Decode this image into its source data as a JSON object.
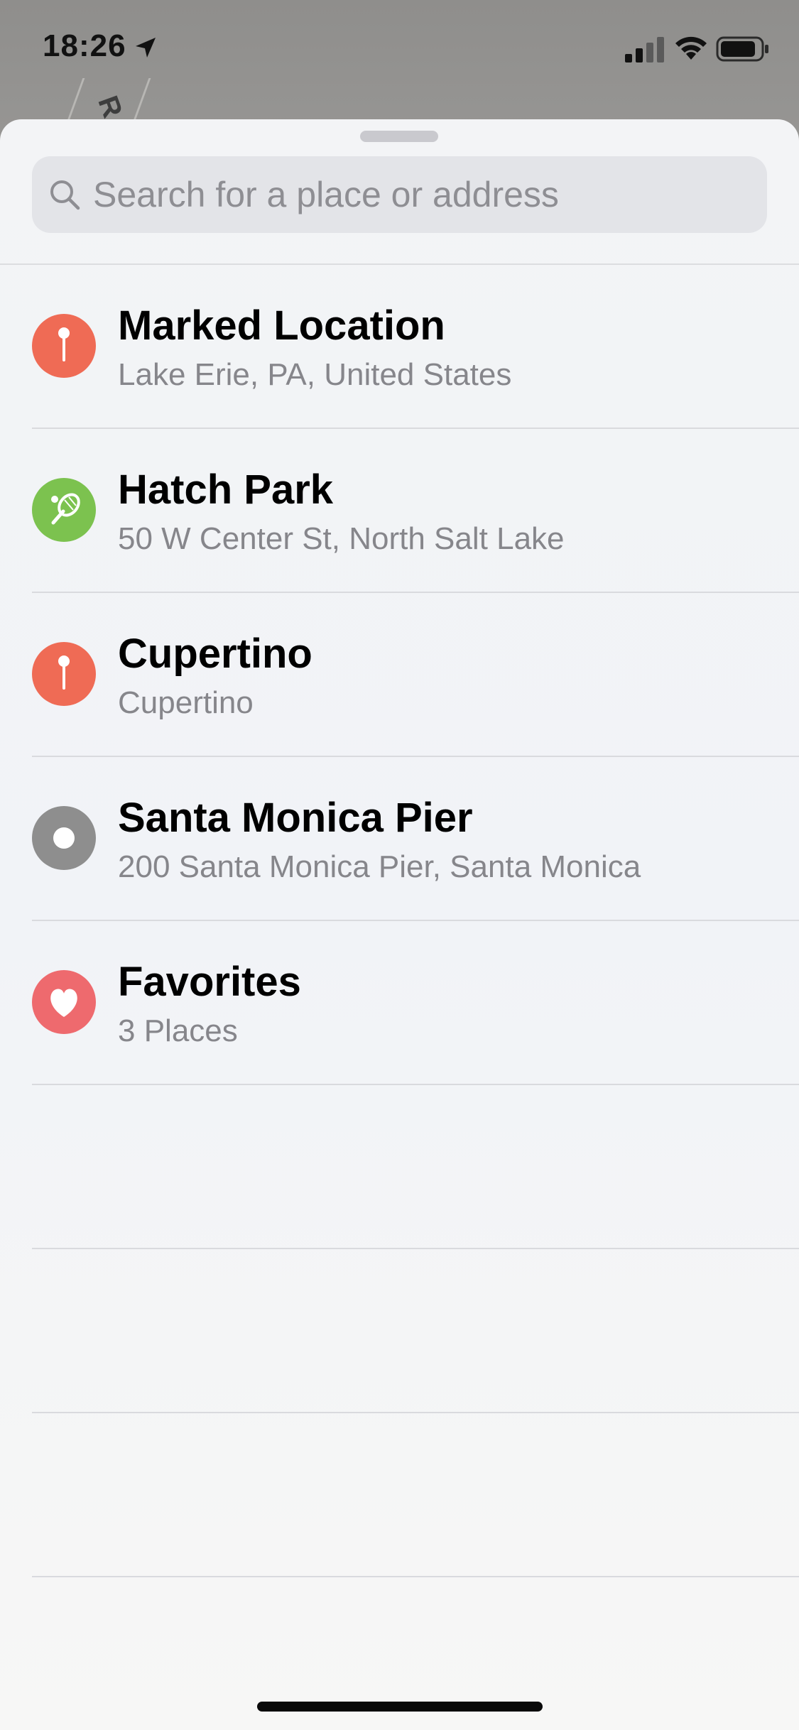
{
  "status_bar": {
    "time": "18:26"
  },
  "map": {
    "road_label": "R"
  },
  "search": {
    "placeholder": "Search for a place or address"
  },
  "places": [
    {
      "title": "Marked Location",
      "subtitle": "Lake Erie, PA, United States",
      "icon": "pin-icon",
      "color": "#ef6b55"
    },
    {
      "title": "Hatch Park",
      "subtitle": "50 W Center St, North Salt Lake",
      "icon": "tennis-icon",
      "color": "#7cc24f"
    },
    {
      "title": "Cupertino",
      "subtitle": "Cupertino",
      "icon": "pin-icon",
      "color": "#ef6b55"
    },
    {
      "title": "Santa Monica Pier",
      "subtitle": "200 Santa Monica Pier, Santa Monica",
      "icon": "dot-icon",
      "color": "#8e8e8e"
    },
    {
      "title": "Favorites",
      "subtitle": "3 Places",
      "icon": "heart-icon",
      "color": "#ee6a6e"
    }
  ]
}
